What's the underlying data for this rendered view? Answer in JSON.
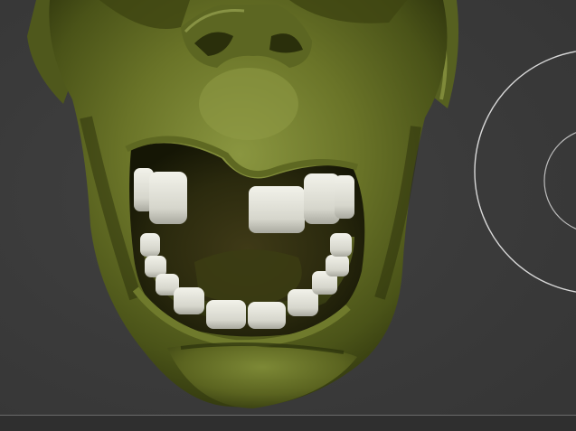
{
  "app": {
    "accent_color": "#6f7b2a",
    "background_color": "#3a3a3a"
  },
  "viewport": {
    "subject": "zombie-head-sculpt",
    "navigation_widget": "rotate-gizmo-rings"
  },
  "icons": {
    "gizmo": "rotate-gizmo-icon"
  }
}
